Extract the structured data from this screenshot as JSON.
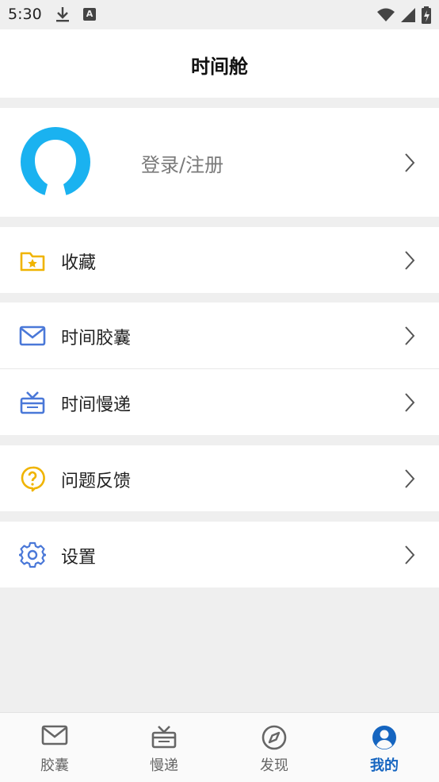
{
  "status_bar": {
    "time": "5:30"
  },
  "header": {
    "title": "时间舱"
  },
  "profile": {
    "login_label": "登录/注册"
  },
  "menu": {
    "favorites": "收藏",
    "time_capsule": "时间胶囊",
    "slow_mail": "时间慢递",
    "feedback": "问题反馈",
    "settings": "设置"
  },
  "tabs": [
    {
      "label": "胶囊",
      "icon": "mail-icon"
    },
    {
      "label": "慢递",
      "icon": "gift-box-icon"
    },
    {
      "label": "发现",
      "icon": "compass-icon"
    },
    {
      "label": "我的",
      "icon": "user-circle-icon",
      "active": true
    }
  ],
  "colors": {
    "accent": "#1565c0",
    "avatar": "#1ab2f0",
    "folder": "#f0b400",
    "mail": "#4a78d8"
  }
}
